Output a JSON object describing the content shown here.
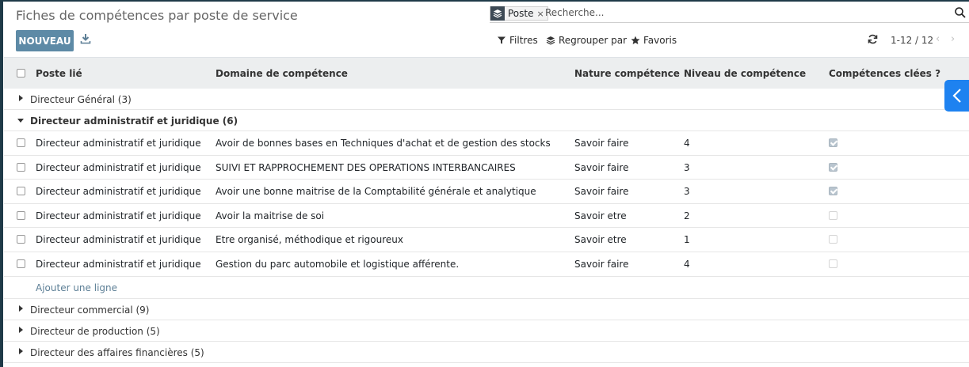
{
  "page_title": "Fiches de compétences par poste de service",
  "search": {
    "facet_label": "Poste",
    "facet_remove": "×",
    "placeholder": "Recherche..."
  },
  "toolbar": {
    "new_label": "NOUVEAU",
    "filters_label": "Filtres",
    "group_by_label": "Regrouper par",
    "favorites_label": "Favoris"
  },
  "pager": {
    "range": "1-12 / 12",
    "prev": "‹",
    "next": "›"
  },
  "table": {
    "columns": [
      "Poste lié",
      "Domaine de compétence",
      "Nature compétence",
      "Niveau de compétence",
      "Compétences clées ?"
    ],
    "groups_before": [
      {
        "label": "Directeur Général (3)"
      }
    ],
    "open_group": {
      "label": "Directeur administratif et juridique (6)",
      "rows": [
        {
          "poste": "Directeur administratif et juridique",
          "domaine": "Avoir de bonnes bases en Techniques d'achat et de gestion des stocks",
          "nature": "Savoir faire",
          "niveau": "4",
          "cle": true
        },
        {
          "poste": "Directeur administratif et juridique",
          "domaine": "SUIVI ET RAPPROCHEMENT DES OPERATIONS INTERBANCAIRES",
          "nature": "Savoir faire",
          "niveau": "3",
          "cle": true
        },
        {
          "poste": "Directeur administratif et juridique",
          "domaine": "Avoir une bonne maitrise de la Comptabilité générale et analytique",
          "nature": "Savoir faire",
          "niveau": "3",
          "cle": true
        },
        {
          "poste": "Directeur administratif et juridique",
          "domaine": "Avoir la maitrise de soi",
          "nature": "Savoir etre",
          "niveau": "2",
          "cle": false
        },
        {
          "poste": "Directeur administratif et juridique",
          "domaine": "Etre organisé, méthodique et rigoureux",
          "nature": "Savoir etre",
          "niveau": "1",
          "cle": false
        },
        {
          "poste": "Directeur administratif et juridique",
          "domaine": "Gestion du parc automobile et logistique afférente.",
          "nature": "Savoir faire",
          "niveau": "4",
          "cle": false
        }
      ],
      "add_line_label": "Ajouter une ligne"
    },
    "groups_after": [
      {
        "label": "Directeur commercial (9)"
      },
      {
        "label": "Directeur de production (5)"
      },
      {
        "label": "Directeur des affaires financières (5)"
      }
    ]
  },
  "icons": {
    "facet": "layers-icon",
    "search": "search-icon",
    "download": "download-icon",
    "filter": "filter-icon",
    "group_by": "layers-icon",
    "favorites": "star-icon",
    "refresh": "refresh-icon",
    "side_panel": "chevron-left-icon"
  },
  "colors": {
    "primary_button": "#5d8aa6",
    "side_tab": "#1e82f0",
    "header_bg": "#eceeef",
    "add_line": "#5d7f96"
  }
}
